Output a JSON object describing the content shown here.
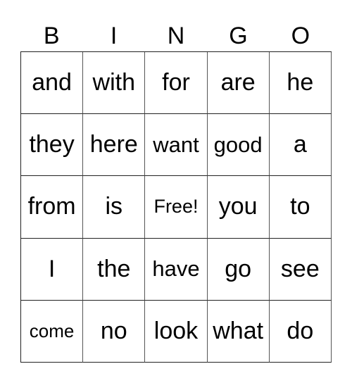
{
  "header": [
    "B",
    "I",
    "N",
    "G",
    "O"
  ],
  "rows": [
    [
      "and",
      "with",
      "for",
      "are",
      "he"
    ],
    [
      "they",
      "here",
      "want",
      "good",
      "a"
    ],
    [
      "from",
      "is",
      "Free!",
      "you",
      "to"
    ],
    [
      "I",
      "the",
      "have",
      "go",
      "see"
    ],
    [
      "come",
      "no",
      "look",
      "what",
      "do"
    ]
  ]
}
